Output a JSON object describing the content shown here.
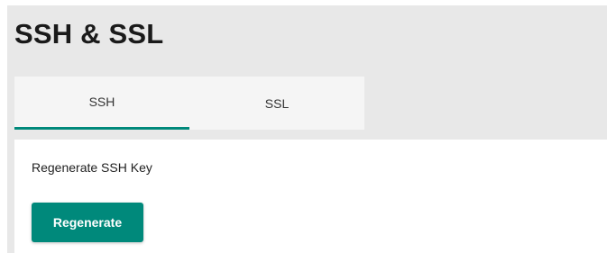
{
  "page": {
    "title": "SSH & SSL"
  },
  "tabs": [
    {
      "label": "SSH",
      "active": true
    },
    {
      "label": "SSL",
      "active": false
    }
  ],
  "ssh_panel": {
    "section_label": "Regenerate SSH Key",
    "regenerate_button": "Regenerate"
  },
  "colors": {
    "accent": "#00897b",
    "page_background": "#e8e8e8",
    "tab_background": "#f5f5f5",
    "panel_background": "#ffffff"
  }
}
